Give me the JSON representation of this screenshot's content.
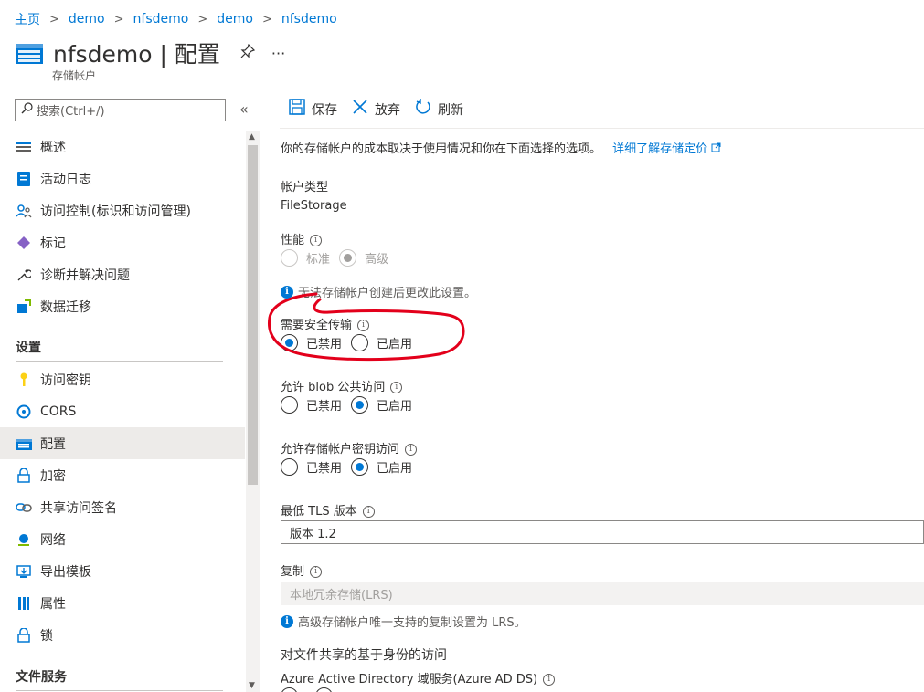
{
  "breadcrumb": [
    "主页",
    "demo",
    "nfsdemo",
    "demo",
    "nfsdemo"
  ],
  "breadcrumb_sep": ">",
  "header": {
    "title": "nfsdemo | 配置",
    "subtitle": "存储帐户",
    "more": "···"
  },
  "search": {
    "placeholder": "搜索(Ctrl+/)",
    "collapse": "«"
  },
  "sidebar": {
    "items": [
      {
        "label": "概述",
        "icon": "overview-icon"
      },
      {
        "label": "活动日志",
        "icon": "activity-log-icon"
      },
      {
        "label": "访问控制(标识和访问管理)",
        "icon": "iam-icon"
      },
      {
        "label": "标记",
        "icon": "tag-icon"
      },
      {
        "label": "诊断并解决问题",
        "icon": "wrench-icon"
      },
      {
        "label": "数据迁移",
        "icon": "migration-icon"
      }
    ],
    "section_settings": "设置",
    "settings_items": [
      {
        "label": "访问密钥",
        "icon": "key-icon"
      },
      {
        "label": "CORS",
        "icon": "cors-icon"
      },
      {
        "label": "配置",
        "icon": "config-icon",
        "selected": true
      },
      {
        "label": "加密",
        "icon": "lock-icon"
      },
      {
        "label": "共享访问签名",
        "icon": "link-icon"
      },
      {
        "label": "网络",
        "icon": "network-icon"
      },
      {
        "label": "导出模板",
        "icon": "export-icon"
      },
      {
        "label": "属性",
        "icon": "properties-icon"
      },
      {
        "label": "锁",
        "icon": "lock-icon"
      }
    ],
    "section_files": "文件服务"
  },
  "toolbar": {
    "save": "保存",
    "discard": "放弃",
    "refresh": "刷新"
  },
  "main": {
    "intro": "你的存储帐户的成本取决于使用情况和你在下面选择的选项。",
    "intro_link": "详细了解存储定价",
    "account_type_label": "帐户类型",
    "account_type_value": "FileStorage",
    "performance_label": "性能",
    "performance_options": [
      "标准",
      "高级"
    ],
    "performance_selected": "高级",
    "performance_note": "无法存储帐户创建后更改此设置。",
    "secure_transfer_label": "需要安全传输",
    "secure_transfer_options": [
      "已禁用",
      "已启用"
    ],
    "secure_transfer_selected": "已禁用",
    "blob_public_label": "允许 blob 公共访问",
    "blob_public_options": [
      "已禁用",
      "已启用"
    ],
    "blob_public_selected": "已启用",
    "key_access_label": "允许存储帐户密钥访问",
    "key_access_options": [
      "已禁用",
      "已启用"
    ],
    "key_access_selected": "已启用",
    "tls_label": "最低 TLS 版本",
    "tls_value": "版本 1.2",
    "replication_label": "复制",
    "replication_value": "本地冗余存储(LRS)",
    "replication_note": "高级存储帐户唯一支持的复制设置为 LRS。",
    "identity_heading": "对文件共享的基于身份的访问",
    "aad_ds_label": "Azure Active Directory 域服务(Azure AD DS)"
  },
  "colors": {
    "accent": "#0078d4",
    "annotation": "#e3001b"
  }
}
